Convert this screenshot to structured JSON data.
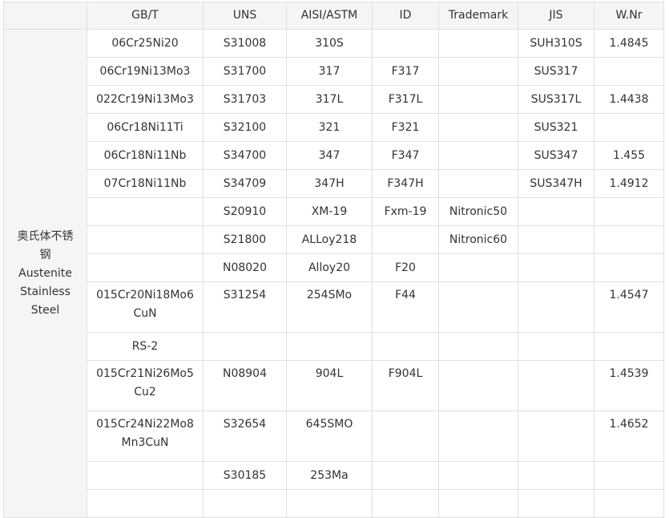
{
  "headers": [
    "",
    "GB/T",
    "UNS",
    "AISI/ASTM",
    "ID",
    "Trademark",
    "JIS",
    "W.Nr"
  ],
  "group": {
    "label_cn_1": "奥氏体不锈",
    "label_cn_2": "钢",
    "label_en_1": "Austenite",
    "label_en_2": "Stainless",
    "label_en_3": "Steel"
  },
  "rows": [
    {
      "gbt": [
        "06Cr25Ni20"
      ],
      "uns": "S31008",
      "aisi": "310S",
      "id": "",
      "trademark": "",
      "jis": "SUH310S",
      "wnr": "1.4845"
    },
    {
      "gbt": [
        "06Cr19Ni13Mo3"
      ],
      "uns": "S31700",
      "aisi": "317",
      "id": "F317",
      "trademark": "",
      "jis": "SUS317",
      "wnr": ""
    },
    {
      "gbt": [
        "022Cr19Ni13Mo3"
      ],
      "uns": "S31703",
      "aisi": "317L",
      "id": "F317L",
      "trademark": "",
      "jis": "SUS317L",
      "wnr": "1.4438"
    },
    {
      "gbt": [
        "06Cr18Ni11Ti"
      ],
      "uns": "S32100",
      "aisi": "321",
      "id": "F321",
      "trademark": "",
      "jis": "SUS321",
      "wnr": ""
    },
    {
      "gbt": [
        "06Cr18Ni11Nb"
      ],
      "uns": "S34700",
      "aisi": "347",
      "id": "F347",
      "trademark": "",
      "jis": "SUS347",
      "wnr": "1.455"
    },
    {
      "gbt": [
        "07Cr18Ni11Nb"
      ],
      "uns": "S34709",
      "aisi": "347H",
      "id": "F347H",
      "trademark": "",
      "jis": "SUS347H",
      "wnr": "1.4912"
    },
    {
      "gbt": [
        ""
      ],
      "uns": "S20910",
      "aisi": "XM-19",
      "id": "Fxm-19",
      "trademark": "Nitronic50",
      "jis": "",
      "wnr": ""
    },
    {
      "gbt": [
        ""
      ],
      "uns": "S21800",
      "aisi": "ALLoy218",
      "id": "",
      "trademark": "Nitronic60",
      "jis": "",
      "wnr": ""
    },
    {
      "gbt": [
        ""
      ],
      "uns": "N08020",
      "aisi": "Alloy20",
      "id": "F20",
      "trademark": "",
      "jis": "",
      "wnr": ""
    },
    {
      "gbt": [
        "015Cr20Ni18Mo6",
        "CuN"
      ],
      "uns": "S31254",
      "aisi": "254SMo",
      "id": "F44",
      "trademark": "",
      "jis": "",
      "wnr": "1.4547"
    },
    {
      "gbt": [
        "RS-2"
      ],
      "uns": "",
      "aisi": "",
      "id": "",
      "trademark": "",
      "jis": "",
      "wnr": ""
    },
    {
      "gbt": [
        "015Cr21Ni26Mo5",
        "Cu2"
      ],
      "uns": "N08904",
      "aisi": "904L",
      "id": "F904L",
      "trademark": "",
      "jis": "",
      "wnr": "1.4539"
    },
    {
      "gbt": [
        "015Cr24Ni22Mo8",
        "Mn3CuN"
      ],
      "uns": "S32654",
      "aisi": "645SMO",
      "id": "",
      "trademark": "",
      "jis": "",
      "wnr": "1.4652"
    },
    {
      "gbt": [
        ""
      ],
      "uns": "S30185",
      "aisi": "253Ma",
      "id": "",
      "trademark": "",
      "jis": "",
      "wnr": ""
    }
  ]
}
